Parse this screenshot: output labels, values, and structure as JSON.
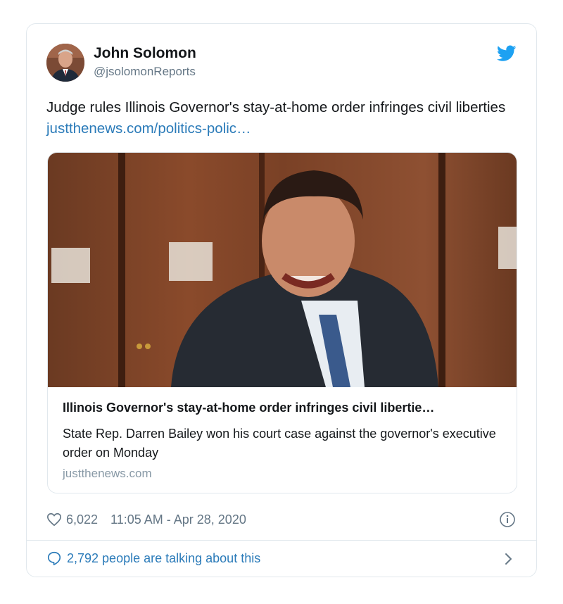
{
  "tweet": {
    "author_name": "John Solomon",
    "author_handle": "@jsolomonReports",
    "text": "Judge rules Illinois Governor's stay-at-home order infringes civil liberties ",
    "link_text": "justthenews.com/politics-polic…"
  },
  "card": {
    "title": "Illinois Governor's stay-at-home order infringes civil libertie…",
    "description": "State Rep. Darren Bailey won his court case against the governor's executive order on Monday",
    "domain": "justthenews.com"
  },
  "meta": {
    "likes": "6,022",
    "timestamp": "11:05 AM - Apr 28, 2020"
  },
  "footer": {
    "talking_label": "2,792 people are talking about this"
  },
  "colors": {
    "link": "#2b7bb9",
    "twitter_blue": "#1da1f2",
    "muted": "#657786",
    "border": "#e1e8ed"
  },
  "icons": [
    "twitter-bird-icon",
    "heart-icon",
    "info-icon",
    "comment-bubble-icon",
    "chevron-right-icon"
  ]
}
